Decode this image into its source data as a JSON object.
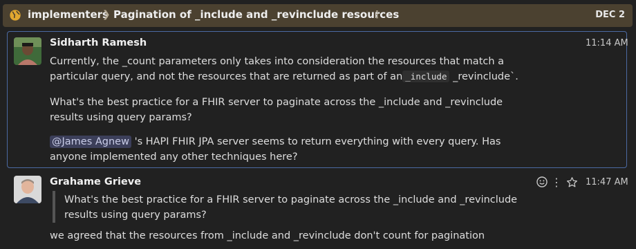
{
  "header": {
    "stream": "implementers",
    "topic": "Pagination of _include and _revinclude resources",
    "date": "DEC 2",
    "icons": {
      "stream": "globe-icon",
      "separator": "chevron-right-icon",
      "menu": "kebab-icon"
    }
  },
  "messages": [
    {
      "sender": "Sidharth Ramesh",
      "time": "11:14 AM",
      "p1_before": "Currently, the _count parameters only takes into consideration the resources that match a particular query, and not the resources that are returned as part of an",
      "p1_code": "_include",
      "p1_after": " _revinclude`.",
      "p2": "What's the best practice for a FHIR server to paginate across the _include and _revinclude results using query params?",
      "mention": "@James Agnew",
      "p3_after": " 's HAPI FHIR JPA server seems to return everything with every query. Has anyone implemented any other techniques here?"
    },
    {
      "sender": "Grahame Grieve",
      "time": "11:47 AM",
      "quote": "What's the best practice for a FHIR server to paginate across the _include and _revinclude results using query params?",
      "body": "we agreed that the resources from _include and _revinclude don't count for pagination",
      "icons": {
        "emoji": "smile-icon",
        "menu": "kebab-icon",
        "star": "star-icon"
      }
    }
  ],
  "colors": {
    "background": "#212121",
    "header": "#4b4130",
    "selected_border": "#4c6aa3",
    "mention_bg": "#3c3f5a"
  }
}
